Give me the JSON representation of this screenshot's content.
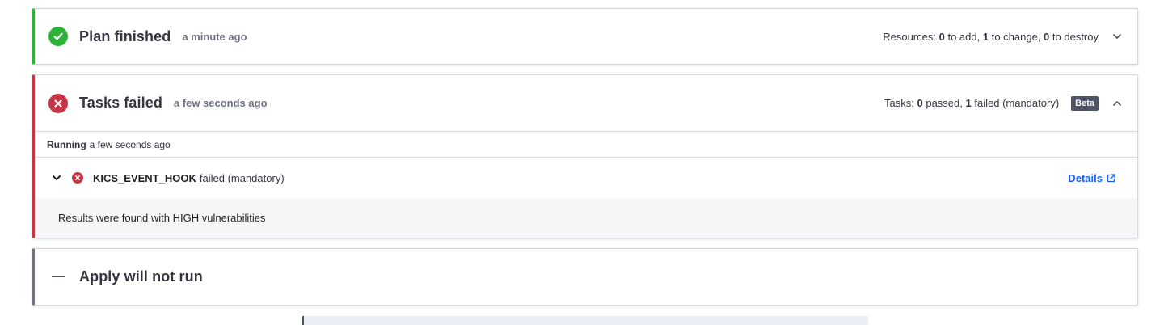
{
  "plan": {
    "title": "Plan finished",
    "time": "a minute ago",
    "resources_label": "Resources:",
    "to_add_count": "0",
    "to_add_label": "to add,",
    "to_change_count": "1",
    "to_change_label": "to change,",
    "to_destroy_count": "0",
    "to_destroy_label": "to destroy",
    "status_color": "#2eb039"
  },
  "tasks": {
    "title": "Tasks failed",
    "time": "a few seconds ago",
    "tasks_label": "Tasks:",
    "passed_count": "0",
    "passed_label": "passed,",
    "failed_count": "1",
    "failed_label": "failed (mandatory)",
    "badge": "Beta",
    "status_color": "#c73445",
    "running_label": "Running",
    "running_time": "a few seconds ago",
    "hook": {
      "name": "KICS_EVENT_HOOK",
      "status": "failed (mandatory)",
      "details_label": "Details",
      "result": "Results were found with HIGH vulnerabilities"
    }
  },
  "apply": {
    "title": "Apply will not run",
    "status_color": "#6f7482"
  },
  "link_color": "#1563ff"
}
